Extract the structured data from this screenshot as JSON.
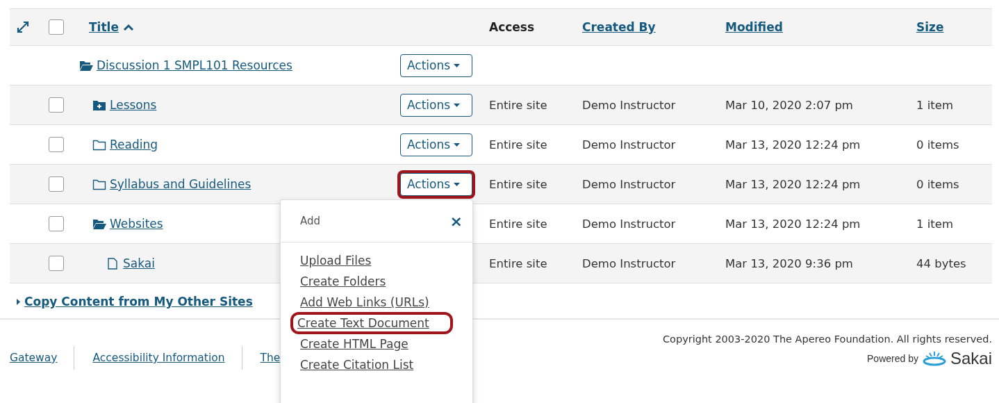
{
  "table": {
    "select_all_checked": false,
    "columns": [
      {
        "label": "Title",
        "link": true,
        "sorted": true
      },
      {
        "label": "Access",
        "link": false,
        "sorted": false
      },
      {
        "label": "Created By",
        "link": true,
        "sorted": false
      },
      {
        "label": "Modified",
        "link": true,
        "sorted": false
      },
      {
        "label": "Size",
        "link": true,
        "sorted": false
      }
    ],
    "rows": [
      {
        "title": "Discussion 1 SMPL101 Resources",
        "kind": "open-folder",
        "actions": "Actions",
        "highlighted": false,
        "children": [
          {
            "title": "Lessons",
            "kind": "folder-plus",
            "checked": false,
            "actions": "Actions",
            "highlighted": false,
            "access": "Entire site",
            "created_by": "Demo Instructor",
            "modified": "Mar 10, 2020 2:07 pm",
            "size": "1 item"
          },
          {
            "title": "Reading",
            "kind": "folder",
            "checked": false,
            "actions": "Actions",
            "highlighted": false,
            "access": "Entire site",
            "created_by": "Demo Instructor",
            "modified": "Mar 13, 2020 12:24 pm",
            "size": "0 items"
          },
          {
            "title": "Syllabus and Guidelines",
            "kind": "folder",
            "checked": false,
            "actions": "Actions",
            "highlighted": true,
            "access": "Entire site",
            "created_by": "Demo Instructor",
            "modified": "Mar 13, 2020 12:24 pm",
            "size": "0 items"
          },
          {
            "title": "Websites",
            "kind": "open-folder",
            "checked": false,
            "access": "Entire site",
            "created_by": "Demo Instructor",
            "modified": "Mar 13, 2020 12:24 pm",
            "size": "1 item",
            "children": [
              {
                "title": "Sakai",
                "kind": "file",
                "checked": false,
                "access": "Entire site",
                "created_by": "Demo Instructor",
                "modified": "Mar 13, 2020 9:36 pm",
                "size": "44 bytes"
              }
            ]
          }
        ]
      }
    ]
  },
  "copy_content_link": "Copy Content from My Other Sites",
  "actions_menu": {
    "title": "Add",
    "close": "×",
    "items": [
      {
        "label": "Upload Files",
        "highlighted": false
      },
      {
        "label": "Create Folders",
        "highlighted": false
      },
      {
        "label": "Add Web Links (URLs)",
        "highlighted": false
      },
      {
        "label": "Create Text Document",
        "highlighted": true
      },
      {
        "label": "Create HTML Page",
        "highlighted": false
      },
      {
        "label": "Create Citation List",
        "highlighted": false
      }
    ]
  },
  "footer": {
    "links": [
      "Gateway",
      "Accessibility Information",
      "The"
    ],
    "copyright": "Copyright 2003-2020 The Apereo Foundation. All rights reserved.",
    "powered_by": "Powered by",
    "logo_text": "Sakai"
  }
}
